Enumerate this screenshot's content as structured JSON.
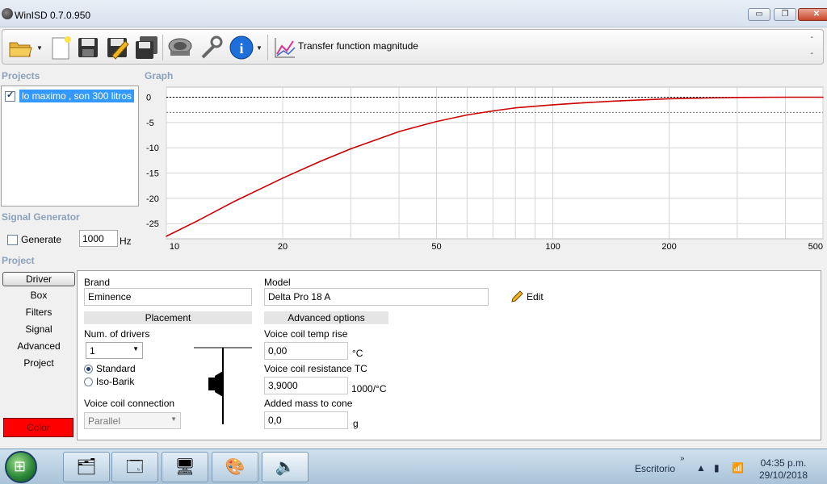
{
  "window": {
    "title": "WinISD 0.7.0.950",
    "minimize": "▭",
    "restore": "❐",
    "close": "✕"
  },
  "toolbar": {
    "view_label": "Transfer function magnitude",
    "icons": [
      "open-folder-icon",
      "new-document-icon",
      "save-icon",
      "edit-save-icon",
      "save-all-icon",
      "speaker-icon",
      "tools-icon",
      "info-icon",
      "chart-icon"
    ]
  },
  "sections": {
    "projects": "Projects",
    "graph": "Graph",
    "signal_generator": "Signal Generator",
    "project": "Project"
  },
  "projects": {
    "items": [
      {
        "label": "lo maximo , son  300 litros",
        "checked": true
      }
    ]
  },
  "signal_generator": {
    "generate_label": "Generate",
    "frequency": "1000",
    "unit": "Hz",
    "checked": false
  },
  "project_nav": {
    "items": [
      "Driver",
      "Box",
      "Filters",
      "Signal",
      "Advanced",
      "Project"
    ],
    "active": "Driver",
    "color_label": "Color",
    "color_value": "#ff0000"
  },
  "driver": {
    "brand_label": "Brand",
    "brand_value": "Eminence",
    "model_label": "Model",
    "model_value": "Delta Pro 18 A",
    "edit_label": "Edit",
    "placement_header": "Placement",
    "num_drivers_label": "Num. of drivers",
    "num_drivers_value": "1",
    "standard_label": "Standard",
    "isobarik_label": "Iso-Barik",
    "vc_connection_label": "Voice coil connection",
    "vc_connection_value": "Parallel",
    "advanced_header": "Advanced options",
    "vc_temp_rise_label": "Voice coil temp rise",
    "vc_temp_rise_value": "0,00",
    "vc_temp_rise_unit": "°C",
    "vc_resistance_tc_label": "Voice coil resistance TC",
    "vc_resistance_tc_value": "3,9000",
    "vc_resistance_tc_unit": "1000/°C",
    "added_mass_label": "Added mass to cone",
    "added_mass_value": "0,0",
    "added_mass_unit": "g"
  },
  "taskbar": {
    "desktop_label": "Escritorio",
    "time": "04:35 p.m.",
    "date": "29/10/2018"
  },
  "chart_data": {
    "type": "line",
    "title": "",
    "xlabel": "",
    "ylabel": "",
    "x_scale": "log",
    "xlim": [
      10,
      500
    ],
    "ylim": [
      -28,
      2
    ],
    "x_ticks": [
      10,
      20,
      50,
      100,
      200,
      500
    ],
    "y_ticks": [
      0,
      -5,
      -10,
      -15,
      -20,
      -25
    ],
    "reference_lines": [
      0,
      -3
    ],
    "grid": true,
    "series": [
      {
        "color": "#cc0000",
        "x": [
          10,
          12,
          15,
          20,
          25,
          30,
          40,
          50,
          60,
          70,
          80,
          100,
          120,
          150,
          200,
          250,
          300,
          400,
          500
        ],
        "y": [
          -27.5,
          -24.5,
          -20.6,
          -16.0,
          -12.7,
          -10.2,
          -6.8,
          -4.8,
          -3.5,
          -2.7,
          -2.1,
          -1.5,
          -1.1,
          -0.7,
          -0.3,
          -0.15,
          -0.05,
          0.0,
          0.0
        ]
      }
    ]
  }
}
